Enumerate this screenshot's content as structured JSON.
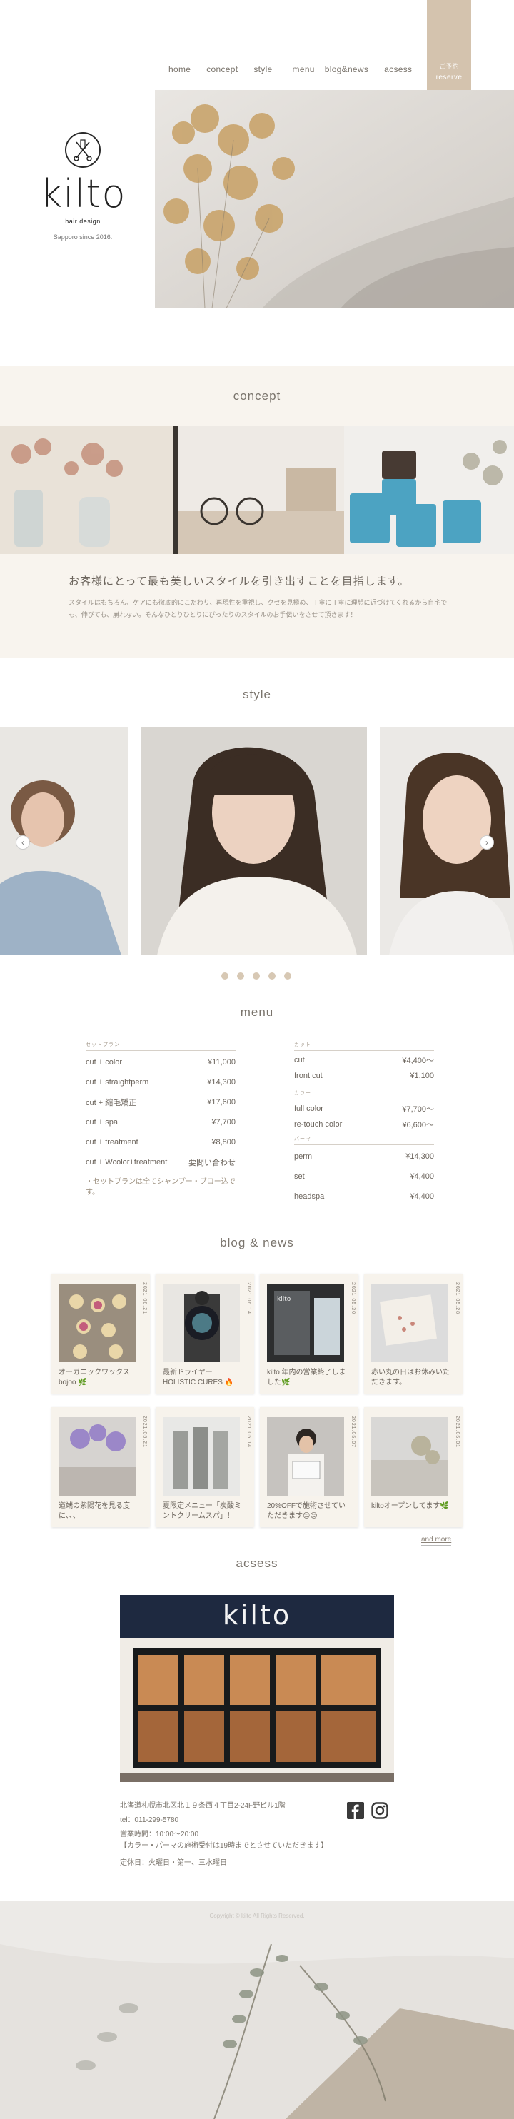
{
  "nav": [
    "home",
    "concept",
    "style",
    "menu",
    "blog&news",
    "acsess"
  ],
  "reserve": {
    "jp": "ご予約",
    "en": "reserve"
  },
  "logo": {
    "word": "kilto",
    "sub": "hair design",
    "since": "Sapporo since 2016."
  },
  "concept": {
    "title": "concept",
    "heading": "お客様にとって最も美しいスタイルを引き出すことを目指します。",
    "body": "スタイルはもちろん、ケアにも徹底的にこだわり、再現性を重視し、クセを見極め、丁寧に丁寧に理想に近づけてくれるから自宅でも、伸びても、崩れない。そんなひとりひとりにぴったりのスタイルのお手伝いをさせて頂きます！"
  },
  "style": {
    "title": "style"
  },
  "menu": {
    "title": "menu",
    "left_cat": "セットプラン",
    "left": [
      {
        "name": "cut + color",
        "price": "¥11,000"
      },
      {
        "name": "cut + straightperm",
        "price": "¥14,300"
      },
      {
        "name": "cut + 縮毛矯正",
        "price": "¥17,600"
      },
      {
        "name": "cut + spa",
        "price": "¥7,700"
      },
      {
        "name": "cut + treatment",
        "price": "¥8,800"
      },
      {
        "name": "cut + Wcolor+treatment",
        "price": "要問い合わせ"
      }
    ],
    "left_note": "・セットプランは全てシャンプー・ブロー込です。",
    "right_cut_cat": "カット",
    "right_cut": [
      {
        "name": "cut",
        "price": "¥4,400〜"
      },
      {
        "name": "front cut",
        "price": "¥1,100"
      }
    ],
    "right_color_cat": "カラー",
    "right_color": [
      {
        "name": "full color",
        "price": "¥7,700〜"
      },
      {
        "name": "re-touch color",
        "price": "¥6,600〜"
      }
    ],
    "right_perm_cat": "パーマ",
    "right_perm": [
      {
        "name": "perm",
        "price": "¥14,300"
      },
      {
        "name": "set",
        "price": "¥4,400"
      },
      {
        "name": "headspa",
        "price": "¥4,400"
      }
    ]
  },
  "blog": {
    "title": "blog & news",
    "more": "and more",
    "posts": [
      {
        "date": "2021.06.21",
        "title": "オーガニックワックス bojoo 🌿"
      },
      {
        "date": "2021.06.14",
        "title": "最新ドライヤー HOLISTIC CURES 🔥"
      },
      {
        "date": "2021.05.30",
        "title": "kilto 年内の営業終了しました🌿"
      },
      {
        "date": "2021.05.28",
        "title": "赤い丸の日はお休みいただきます。"
      },
      {
        "date": "2021.05.21",
        "title": "道端の紫陽花を見る度に、、、"
      },
      {
        "date": "2021.05.14",
        "title": "夏限定メニュー「炭酸ミントクリームスパ」！"
      },
      {
        "date": "2021.05.07",
        "title": "20%OFFで施術させていただきます😊😊"
      },
      {
        "date": "2021.05.01",
        "title": "kiltoオープンしてます🌿"
      }
    ]
  },
  "acsess": {
    "title": "acsess",
    "sign": "kilto",
    "address": "北海道札幌市北区北１９条西４丁目2-24F野ビル1階",
    "tel": "tel：011-299-5780",
    "hours": "営業時間：10:00〜20:00",
    "note": "【カラー・パーマの施術受付は19時までとさせていただきます】",
    "holiday": "定休日：火曜日・第一、三水曜日"
  },
  "footer": {
    "copyright": "Copyright © kilto All Rights Reserved."
  },
  "icons": {
    "facebook": "facebook-icon",
    "instagram": "instagram-icon"
  },
  "colors": {
    "accent": "#d4c3ae",
    "beige_bg": "#f8f4ee",
    "dot": "#d7c8b4"
  }
}
